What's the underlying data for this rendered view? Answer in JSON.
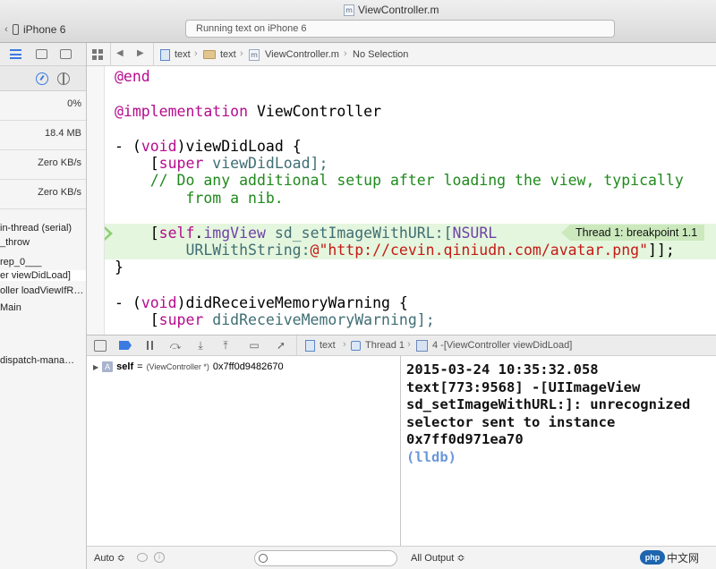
{
  "window": {
    "title": "ViewController.m",
    "file_badge": "m"
  },
  "toolbar": {
    "scheme_device": "iPhone 6",
    "activity_status": "Running text on iPhone 6"
  },
  "navigator": {
    "gauges": [
      "0%",
      "18.4 MB",
      "Zero KB/s",
      "Zero KB/s"
    ],
    "stack_lines": [
      "in-thread (serial)",
      "_throw",
      "rep_0___",
      "er viewDidLoad]",
      "oller loadViewIfR…",
      "Main",
      "dispatch-mana…"
    ]
  },
  "jumpbar": {
    "crumbs": [
      "text",
      "text",
      "ViewController.m",
      "No Selection"
    ]
  },
  "editor": {
    "breakpoint_label": "Thread 1: breakpoint 1.1",
    "lines": {
      "end": "@end",
      "impl_kw": "@implementation",
      "impl_name": " ViewController",
      "vdl_a": "- (",
      "vdl_void": "void",
      "vdl_b": ")viewDidLoad {",
      "super_a": "    [",
      "super_kw": "super",
      "super_b": " viewDidLoad];",
      "comment1": "    // Do any additional setup after loading the view, typically",
      "comment2": "        from a nib.",
      "img_a": "    [",
      "img_self": "self",
      "img_dot": ".",
      "img_prop": "imgView",
      "img_meth": " sd_setImageWithURL:[",
      "img_cls": "NSURL",
      "url_meth": "        URLWithString:",
      "url_str": "@\"http://cevin.qiniudn.com/avatar.png\"",
      "url_end": "]];",
      "close": "}",
      "mem_a": "- (",
      "mem_void": "void",
      "mem_b": ")didReceiveMemoryWarning {",
      "msuper_a": "    [",
      "msuper_kw": "super",
      "msuper_b": " didReceiveMemoryWarning];"
    }
  },
  "debugbar": {
    "crumb_project": "text",
    "crumb_thread": "Thread 1",
    "crumb_frame": "4 -[ViewController viewDidLoad]"
  },
  "variables": {
    "badge": "A",
    "name": "self",
    "eq": "=",
    "type": "(ViewController *)",
    "value": "0x7ff0d9482670",
    "scope": "Auto ≎"
  },
  "console": {
    "lines": [
      "2015-03-24 10:35:32.058",
      "text[773:9568] -[UIImageView",
      "sd_setImageWithURL:]: unrecognized",
      "selector sent to instance",
      "0x7ff0d971ea70"
    ],
    "prompt": "(lldb)",
    "output_select": "All Output ≎"
  },
  "watermark": {
    "logo": "php",
    "site": "中文网"
  }
}
